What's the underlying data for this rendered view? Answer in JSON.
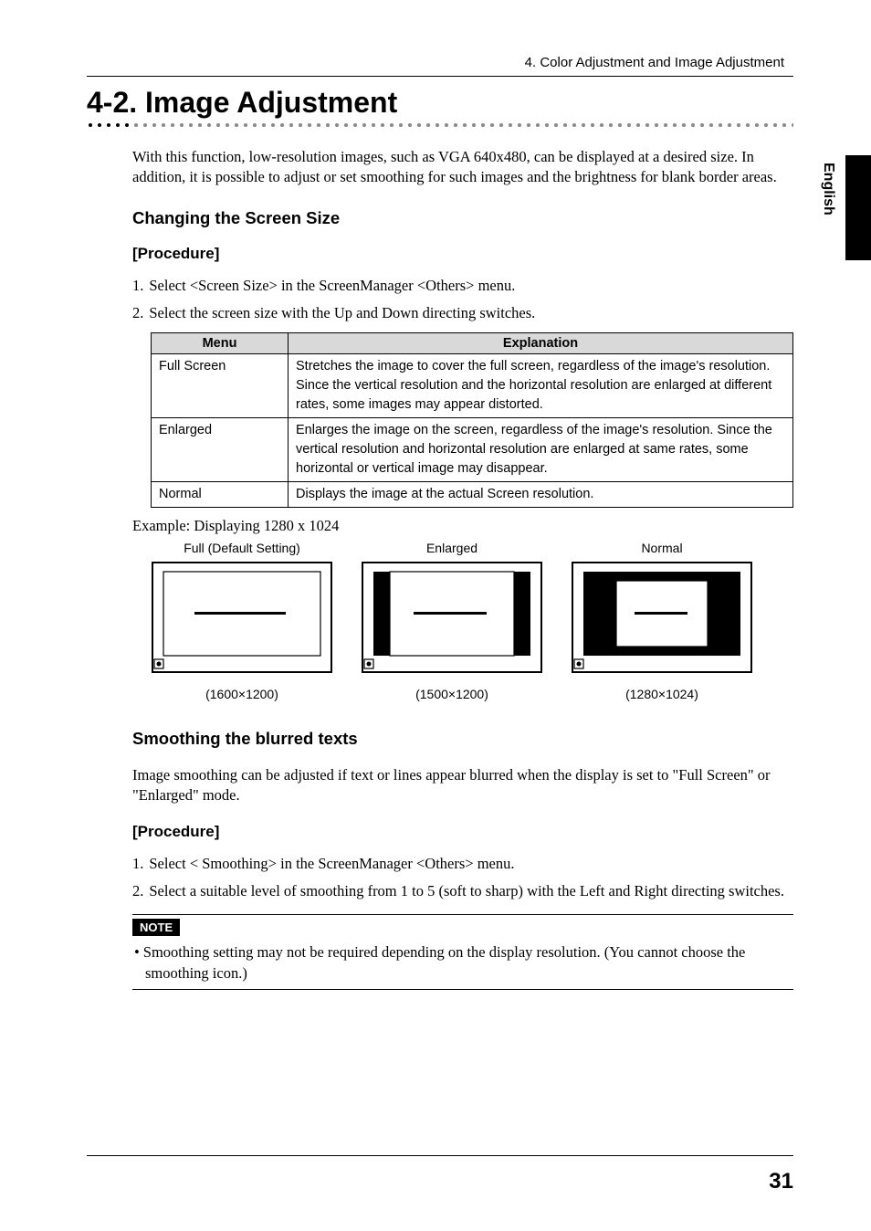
{
  "header": {
    "chapter": "4. Color Adjustment and Image Adjustment"
  },
  "section": {
    "title": "4-2. Image Adjustment",
    "intro": "With this function, low-resolution images, such as VGA 640x480, can be displayed at a desired size. In addition, it is possible to adjust or set smoothing for such images and the brightness for blank border areas."
  },
  "changing": {
    "heading": "Changing the Screen Size",
    "proc_heading": "[Procedure]",
    "steps": [
      "Select <Screen Size> in the ScreenManager <Others> menu.",
      "Select the screen size with the Up and Down directing switches."
    ]
  },
  "table": {
    "head_menu": "Menu",
    "head_expl": "Explanation",
    "rows": [
      {
        "menu": "Full Screen",
        "expl": "Stretches the image to cover the full screen, regardless of the image's resolution.  Since the vertical resolution and the horizontal resolution are enlarged at different rates, some images may appear distorted."
      },
      {
        "menu": "Enlarged",
        "expl": "Enlarges the image on the screen, regardless of the image's resolution. Since the vertical resolution and horizontal resolution are enlarged at same rates, some horizontal or vertical image may disappear."
      },
      {
        "menu": "Normal",
        "expl": "Displays the image at the actual Screen resolution."
      }
    ]
  },
  "example": {
    "caption": "Example: Displaying 1280 x 1024",
    "items": [
      {
        "label": "Full (Default Setting)",
        "res": "(1600×1200)"
      },
      {
        "label": "Enlarged",
        "res": "(1500×1200)"
      },
      {
        "label": "Normal",
        "res": "(1280×1024)"
      }
    ]
  },
  "smoothing": {
    "heading": "Smoothing the blurred texts",
    "desc": "Image smoothing can be adjusted if text or lines appear blurred when the display is set to \"Full Screen\" or \"Enlarged\" mode.",
    "proc_heading": "[Procedure]",
    "steps": [
      "Select < Smoothing> in the ScreenManager <Others> menu.",
      "Select a suitable level of smoothing from 1 to 5 (soft to sharp) with the Left and Right directing switches."
    ]
  },
  "note": {
    "label": "NOTE",
    "text": "Smoothing setting may not be required depending on the display resolution. (You cannot choose the smoothing icon.)"
  },
  "side": {
    "lang": "English"
  },
  "footer": {
    "page": "31"
  },
  "chart_data": {
    "type": "table",
    "title": "Screen Size Modes",
    "columns": [
      "Menu",
      "Explanation"
    ],
    "rows": [
      [
        "Full Screen",
        "Stretches the image to cover the full screen, regardless of the image's resolution. Since the vertical resolution and the horizontal resolution are enlarged at different rates, some images may appear distorted."
      ],
      [
        "Enlarged",
        "Enlarges the image on the screen, regardless of the image's resolution. Since the vertical resolution and horizontal resolution are enlarged at same rates, some horizontal or vertical image may disappear."
      ],
      [
        "Normal",
        "Displays the image at the actual Screen resolution."
      ]
    ]
  }
}
